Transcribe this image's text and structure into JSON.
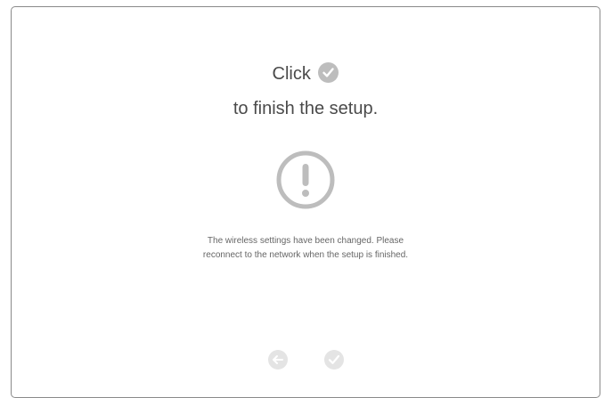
{
  "dialog": {
    "heading_prefix": "Click",
    "heading_suffix": "to finish the setup.",
    "message_line1": "The wireless settings have been changed. Please",
    "message_line2": "reconnect to the network when the setup is finished."
  },
  "icons": {
    "inline": "check-icon",
    "status": "warning-icon",
    "back": "back-arrow-icon",
    "finish": "check-icon"
  },
  "colors": {
    "icon_gray": "#bdbdbd",
    "nav_icon_gray": "#d3d3d3",
    "text": "#4a4a4a",
    "message_text": "#666666",
    "border": "#8a8a8a"
  }
}
